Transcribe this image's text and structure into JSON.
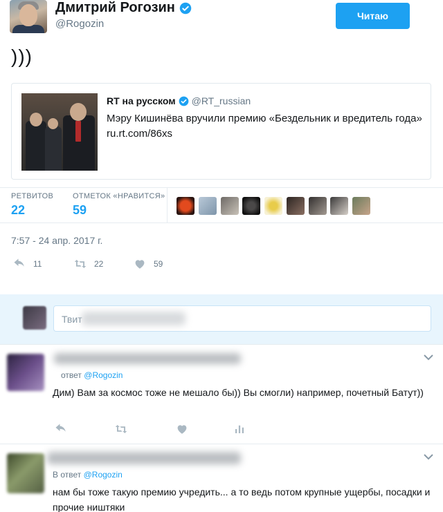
{
  "author": {
    "name": "Дмитрий Рогозин",
    "handle": "@Rogozin",
    "follow_label": "Читаю"
  },
  "tweet": {
    "text": ")))"
  },
  "quote": {
    "name": "RT на русском",
    "handle": "@RT_russian",
    "text": "Мэру Кишинёва вручили премию «Бездельник и вредитель года» ru.rt.com/86xs"
  },
  "stats": {
    "retweets_label": "РЕТВИТОВ",
    "retweets": "22",
    "likes_label": "ОТМЕТОК «НРАВИТСЯ»",
    "likes": "59"
  },
  "timestamp": "7:57 - 24 апр. 2017 г.",
  "actions": {
    "replies": "11",
    "retweets": "22",
    "likes": "59"
  },
  "reply_box": {
    "placeholder": "Твит"
  },
  "replies": [
    {
      "in_reply_prefix": "ответ",
      "in_reply_to": "@Rogozin",
      "text": "Дим) Вам за космос тоже не мешало бы)) Вы смогли)  например, почетный Батут))"
    },
    {
      "in_reply_prefix": "В ответ",
      "in_reply_to": "@Rogozin",
      "text": "нам бы тоже такую премию учредить... а то ведь потом крупные ущербы, посадки и прочие ништяки"
    }
  ],
  "colors": {
    "accent": "#1da1f2",
    "muted": "#657786",
    "icon": "#aab8c2",
    "reply_band": "#e8f5fd"
  },
  "icons": [
    "verified-badge-icon",
    "reply-icon",
    "retweet-icon",
    "heart-icon",
    "analytics-icon",
    "chevron-down-icon"
  ]
}
